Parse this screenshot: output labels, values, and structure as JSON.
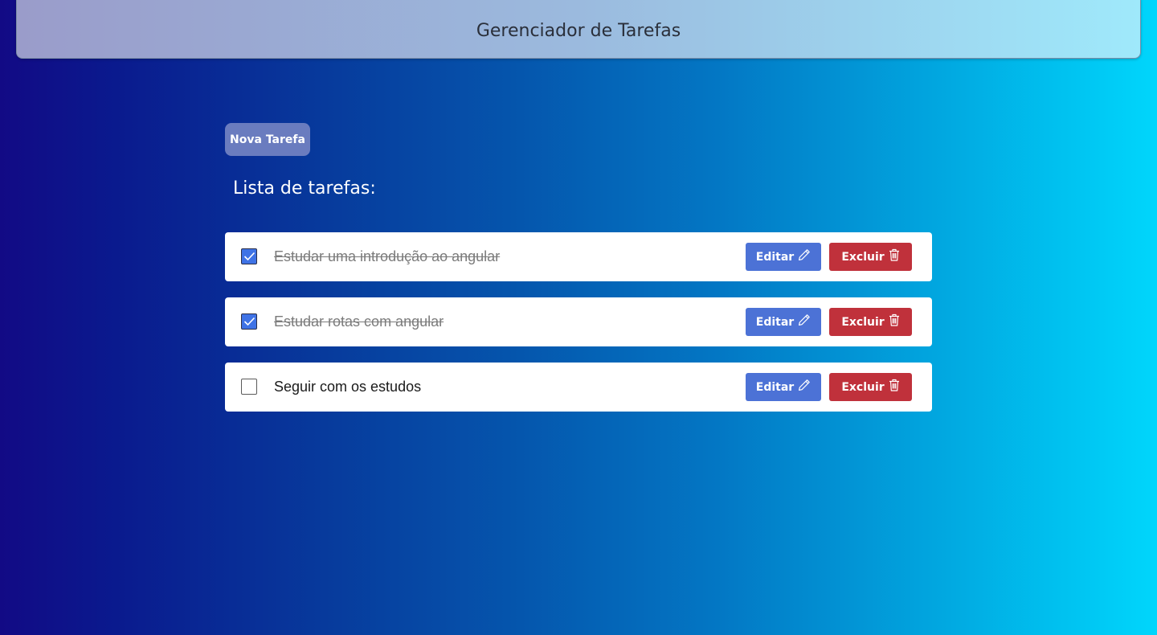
{
  "header": {
    "title": "Gerenciador de Tarefas"
  },
  "toolbar": {
    "new_task_label": "Nova Tarefa"
  },
  "list": {
    "title": "Lista de tarefas:",
    "edit_label": "Editar",
    "delete_label": "Excluir",
    "edit_icon": "pencil-icon",
    "delete_icon": "trash-icon",
    "tasks": [
      {
        "text": "Estudar uma introdução ao angular",
        "done": true
      },
      {
        "text": "Estudar rotas com angular",
        "done": true
      },
      {
        "text": "Seguir com os estudos",
        "done": false
      }
    ]
  },
  "colors": {
    "edit_button": "#4c72d6",
    "delete_button": "#c0313b",
    "new_task_button": "#6a7cbf",
    "checkbox_checked": "#3f73e6"
  }
}
